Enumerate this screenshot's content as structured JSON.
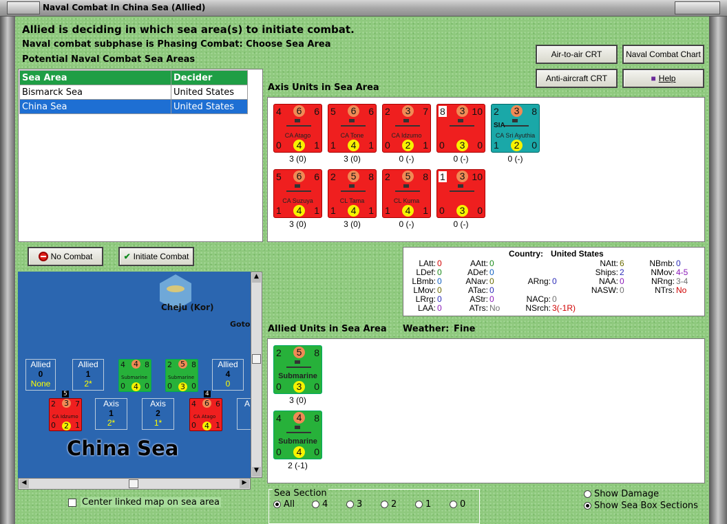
{
  "window": {
    "title": "Naval Combat In China Sea (Allied)"
  },
  "header": {
    "line1": "Allied is deciding in which sea area(s) to initiate combat.",
    "line2": "Naval combat subphase is Phasing Combat: Choose Sea Area",
    "line3": "Potential Naval Combat Sea Areas"
  },
  "buttons": {
    "air_to_air": "Air-to-air CRT",
    "naval_combat_chart": "Naval Combat Chart",
    "anti_aircraft": "Anti-aircraft CRT",
    "help": "Help",
    "no_combat": "No Combat",
    "initiate_combat": "Initiate Combat"
  },
  "sea_table": {
    "headers": [
      "Sea Area",
      "Decider"
    ],
    "rows": [
      [
        "Bismarck Sea",
        "United States"
      ],
      [
        "China Sea",
        "United States"
      ]
    ]
  },
  "axis": {
    "title": "Axis Units in Sea Area",
    "units": [
      {
        "tl": "4",
        "tm": "6",
        "tr": "6",
        "name": "CA Atago",
        "bl": "0",
        "bm": "4",
        "br": "1",
        "color": "red",
        "caption": "3 (0)"
      },
      {
        "tl": "5",
        "tm": "6",
        "tr": "6",
        "name": "CA Tone",
        "bl": "1",
        "bm": "4",
        "br": "1",
        "color": "red",
        "caption": "3 (0)"
      },
      {
        "tl": "2",
        "tm": "3",
        "tr": "7",
        "name": "CA Idzumo",
        "bl": "0",
        "bm": "2",
        "br": "1",
        "color": "red",
        "caption": "0 (-)"
      },
      {
        "tl": "8",
        "tm": "3",
        "tr": "10",
        "name": "",
        "bl": "0",
        "bm": "3",
        "br": "0",
        "color": "red",
        "caption": "0 (-)"
      },
      {
        "tl": "2",
        "tm": "3",
        "tr": "8",
        "name": "CA Sri Ayuthia",
        "nat": "SIA",
        "bl": "1",
        "bm": "2",
        "br": "0",
        "color": "teal",
        "caption": "0 (-)"
      },
      {
        "tl": "5",
        "tm": "6",
        "tr": "6",
        "name": "CA Suzuya",
        "bl": "1",
        "bm": "4",
        "br": "1",
        "color": "red",
        "caption": "3 (0)"
      },
      {
        "tl": "2",
        "tm": "5",
        "tr": "8",
        "name": "CL Tama",
        "bl": "1",
        "bm": "4",
        "br": "1",
        "color": "red",
        "caption": "3 (0)"
      },
      {
        "tl": "2",
        "tm": "5",
        "tr": "8",
        "name": "CL Kuma",
        "bl": "1",
        "bm": "4",
        "br": "1",
        "color": "red",
        "caption": "0 (-)"
      },
      {
        "tl": "1",
        "tm": "3",
        "tr": "10",
        "name": "",
        "bl": "0",
        "bm": "3",
        "br": "0",
        "color": "red",
        "caption": "0 (-)"
      }
    ]
  },
  "stats": {
    "country_label": "Country:",
    "country": "United States",
    "rows": [
      [
        "LAtt:",
        "0",
        "AAtt:",
        "0",
        "",
        "",
        "NAtt:",
        "6",
        "NBmb:",
        "0"
      ],
      [
        "LDef:",
        "0",
        "ADef:",
        "0",
        "",
        "",
        "Ships:",
        "2",
        "NMov:",
        "4-5"
      ],
      [
        "LBmb:",
        "0",
        "ANav:",
        "0",
        "ARng:",
        "0",
        "NAA:",
        "0",
        "NRng:",
        "3-4"
      ],
      [
        "LMov:",
        "0",
        "ATac:",
        "0",
        "",
        "",
        "NASW:",
        "0",
        "NTrs:",
        "No"
      ],
      [
        "LRrg:",
        "0",
        "AStr:",
        "0",
        "NACp:",
        "0",
        "",
        "",
        "",
        ""
      ],
      [
        "LAA:",
        "0",
        "ATrs:",
        "No",
        "NSrch:",
        "3(-1R)",
        "",
        "",
        "",
        ""
      ]
    ]
  },
  "allied": {
    "title": "Allied Units in Sea Area",
    "weather_label": "Weather:",
    "weather": "Fine",
    "units": [
      {
        "tl": "2",
        "tm": "5",
        "tr": "8",
        "name": "Submarine",
        "bl": "0",
        "bm": "3",
        "br": "0",
        "caption": "3 (0)"
      },
      {
        "tl": "4",
        "tm": "4",
        "tr": "8",
        "name": "Submarine",
        "bl": "0",
        "bm": "4",
        "br": "0",
        "caption": "2 (-1)"
      }
    ]
  },
  "map": {
    "sea_name": "China Sea",
    "port": "Cheju (Kor)",
    "goto": "Goto",
    "allied0": {
      "label": "Allied",
      "num": "0",
      "sub": "None"
    },
    "allied1": {
      "label": "Allied",
      "num": "1",
      "sub": "2*"
    },
    "allied4": {
      "label": "Allied",
      "num": "4",
      "sub": "0"
    },
    "axis1": {
      "label": "Axis",
      "num": "1",
      "sub": "2*"
    },
    "axis2": {
      "label": "Axis",
      "num": "2",
      "sub": "1*"
    },
    "axis_partial": "A",
    "stack5": "5",
    "stack4": "4",
    "mini_sub": "Submarine",
    "mini_idzumo": "CA Idzumo",
    "mini_atago": "CA Atago"
  },
  "center_linked": "Center linked map on sea area",
  "sea_section": {
    "label": "Sea Section",
    "options": [
      "All",
      "4",
      "3",
      "2",
      "1",
      "0"
    ],
    "selected": "All"
  },
  "show": {
    "damage": "Show Damage",
    "sections": "Show Sea Box Sections"
  },
  "colors": {
    "red_unit": "#ef1f1f",
    "allied_unit": "#27b13a",
    "teal_unit": "#1aa8a8",
    "selection": "#1e6fd3"
  }
}
